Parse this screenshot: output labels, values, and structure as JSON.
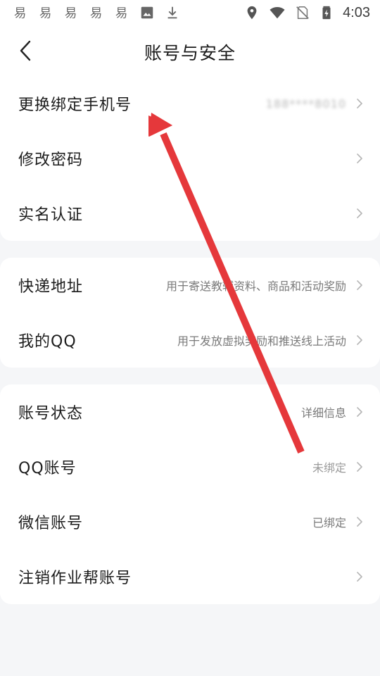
{
  "status_bar": {
    "time": "4:03",
    "left_icons": [
      "app-icon",
      "app-icon",
      "app-icon",
      "app-icon",
      "app-icon",
      "image-icon",
      "download-icon"
    ],
    "right_icons": [
      "location-icon",
      "wifi-icon",
      "no-sim-icon",
      "battery-charging-icon"
    ]
  },
  "header": {
    "title": "账号与安全",
    "back_icon": "chevron-left-icon"
  },
  "groups": [
    {
      "items": [
        {
          "label": "更换绑定手机号",
          "value": "188****8010"
        },
        {
          "label": "修改密码",
          "value": ""
        },
        {
          "label": "实名认证",
          "value": ""
        }
      ]
    },
    {
      "items": [
        {
          "label": "快递地址",
          "value": "用于寄送教辅资料、商品和活动奖励"
        },
        {
          "label": "我的QQ",
          "value": "用于发放虚拟奖励和推送线上活动"
        }
      ]
    },
    {
      "items": [
        {
          "label": "账号状态",
          "value": "详细信息"
        },
        {
          "label": "QQ账号",
          "value": "未绑定"
        },
        {
          "label": "微信账号",
          "value": "已绑定"
        },
        {
          "label": "注销作业帮账号",
          "value": ""
        }
      ]
    }
  ],
  "colors": {
    "background": "#f5f6f8",
    "card": "#ffffff",
    "annotation_arrow": "#e5383b"
  }
}
